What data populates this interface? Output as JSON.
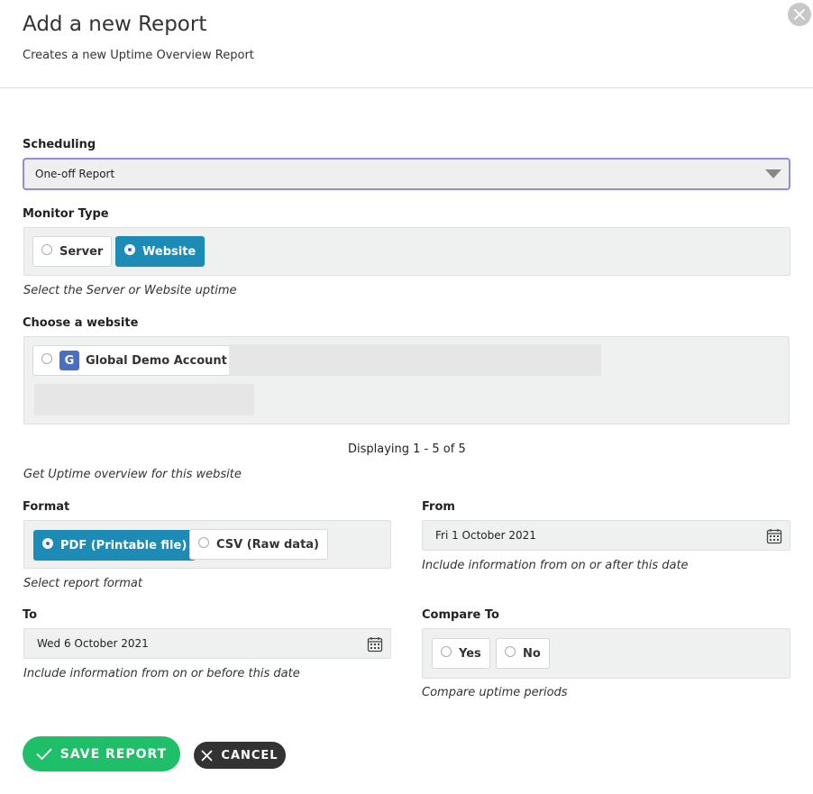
{
  "header": {
    "title": "Add a new Report",
    "subtitle": "Creates a new Uptime Overview Report"
  },
  "scheduling": {
    "label": "Scheduling",
    "selected": "One-off Report"
  },
  "monitor_type": {
    "label": "Monitor Type",
    "options": [
      "Server",
      "Website"
    ],
    "selected": "Website",
    "help": "Select the Server or Website uptime"
  },
  "website": {
    "label": "Choose a website",
    "options": [
      {
        "initial": "G",
        "name": "Global Demo Account"
      }
    ],
    "pager": "Displaying 1 - 5 of 5",
    "help": "Get Uptime overview for this website"
  },
  "format": {
    "label": "Format",
    "options": [
      "PDF (Printable file)",
      "CSV (Raw data)"
    ],
    "selected": "PDF (Printable file)",
    "help": "Select report format"
  },
  "from": {
    "label": "From",
    "value": "Fri 1 October 2021",
    "help": "Include information from on or after this date"
  },
  "to": {
    "label": "To",
    "value": "Wed 6 October 2021",
    "help": "Include information from on or before this date"
  },
  "compare": {
    "label": "Compare To",
    "options": [
      "Yes",
      "No"
    ],
    "help": "Compare uptime periods"
  },
  "actions": {
    "save_label": "SAVE REPORT",
    "cancel_label": "CANCEL"
  },
  "colors": {
    "accent": "#1c8bb6",
    "save": "#1fbf6a",
    "cancel": "#333333",
    "select_border": "#8c8cf0"
  },
  "icons": {
    "close": "close-icon",
    "caret": "chevron-down-icon",
    "calendar": "calendar-icon",
    "check": "check-icon",
    "cancel": "x-icon"
  }
}
